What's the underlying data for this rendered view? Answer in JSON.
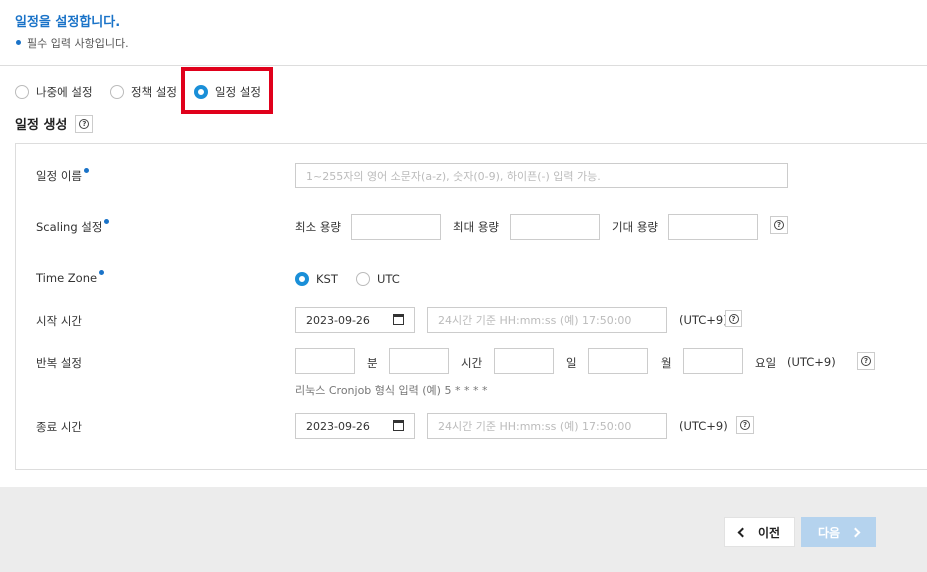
{
  "header": {
    "title": "일정을 설정합니다.",
    "required_note": "필수 입력 사항입니다."
  },
  "schedule_mode": {
    "options": [
      "나중에 설정",
      "정책 설정",
      "일정 설정"
    ],
    "selected": "일정 설정"
  },
  "section": {
    "title": "일정 생성",
    "help_icon": "question-circle-icon"
  },
  "form": {
    "name": {
      "label": "일정 이름",
      "placeholder": "1~255자의 영어 소문자(a-z), 숫자(0-9), 하이픈(-) 입력 가능."
    },
    "scaling": {
      "label": "Scaling 설정",
      "min_label": "최소 용량",
      "max_label": "최대 용량",
      "desired_label": "기대 용량",
      "min": "",
      "max": "",
      "desired": ""
    },
    "timezone": {
      "label": "Time Zone",
      "options": [
        "KST",
        "UTC"
      ],
      "selected": "KST"
    },
    "start": {
      "label": "시작 시간",
      "date": "2023-09-26",
      "time_placeholder": "24시간 기준 HH:mm:ss (예) 17:50:00",
      "tz_suffix": "(UTC+9)"
    },
    "repeat": {
      "label": "반복 설정",
      "minute": "분",
      "hour": "시간",
      "day": "일",
      "month": "월",
      "weekday": "요일",
      "tz_suffix": "(UTC+9)",
      "hint": "리눅스 Cronjob 형식 입력 (예) 5 * * * *"
    },
    "end": {
      "label": "종료 시간",
      "date": "2023-09-26",
      "time_placeholder": "24시간 기준 HH:mm:ss (예) 17:50:00",
      "tz_suffix": "(UTC+9)"
    }
  },
  "footer": {
    "prev_label": "이전",
    "next_label": "다음"
  },
  "colors": {
    "accent": "#1a73c8",
    "radio_on": "#1a8fd8",
    "highlight": "#e0001b",
    "next_disabled": "#b5d3ee"
  }
}
